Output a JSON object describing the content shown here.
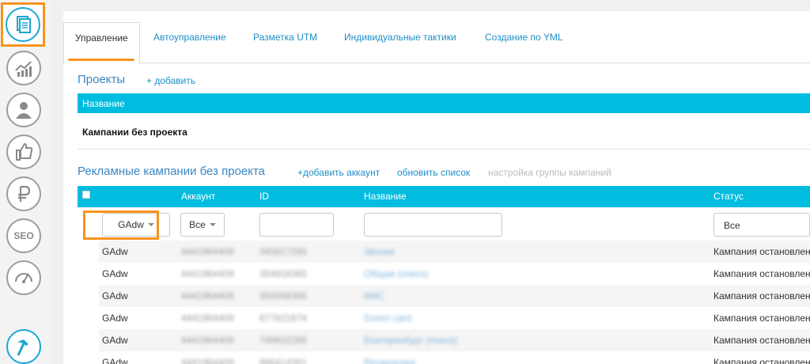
{
  "tabs": [
    {
      "label": "Управление",
      "active": true
    },
    {
      "label": "Автоуправление"
    },
    {
      "label": "Разметка UTM"
    },
    {
      "label": "Индивидуальные тактики"
    },
    {
      "label": "Создание по YML"
    }
  ],
  "projects": {
    "title": "Проекты",
    "add_link": "+ добавить",
    "header_name": "Название",
    "row": "Кампании без проекта"
  },
  "campaigns": {
    "title": "Рекламные кампании без проекта",
    "add_account": "+добавить аккаунт",
    "refresh": "обновить список",
    "group_settings": "настройка группы кампаний",
    "columns": {
      "account": "Аккаунт",
      "id": "ID",
      "name": "Название",
      "status": "Статус"
    },
    "filters": {
      "type": "GAdw",
      "account": "Все",
      "status": "Все"
    },
    "rows": [
      {
        "type": "GAdw",
        "account": "4441964409",
        "id": "345817265",
        "name": "Звонки",
        "status": "Кампания остановлена"
      },
      {
        "type": "GAdw",
        "account": "4441964409",
        "id": "354918365",
        "name": "Общая (поиск)",
        "status": "Кампания остановлена"
      },
      {
        "type": "GAdw",
        "account": "4441964409",
        "id": "355008365",
        "name": "КМС",
        "status": "Кампания остановлена"
      },
      {
        "type": "GAdw",
        "account": "4441964409",
        "id": "677621674",
        "name": "Green card",
        "status": "Кампания остановлена"
      },
      {
        "type": "GAdw",
        "account": "4441964409",
        "id": "749602266",
        "name": "Екатеринбург (поиск)",
        "status": "Кампания остановлена"
      },
      {
        "type": "GAdw",
        "account": "4441964409",
        "id": "886414361",
        "name": "Ретаргетинг",
        "status": "Кампания остановлена"
      }
    ]
  },
  "sidebar": {
    "icons": [
      "documents-icon",
      "analytics-chart-icon",
      "user-profile-icon",
      "thumbs-up-icon",
      "ruble-icon",
      "seo-icon",
      "speedometer-icon",
      "hammer-icon"
    ],
    "seo_label": "SEO"
  },
  "colors": {
    "accent": "#00bde0",
    "highlight": "#f7941d",
    "link": "#1d8fc8"
  }
}
